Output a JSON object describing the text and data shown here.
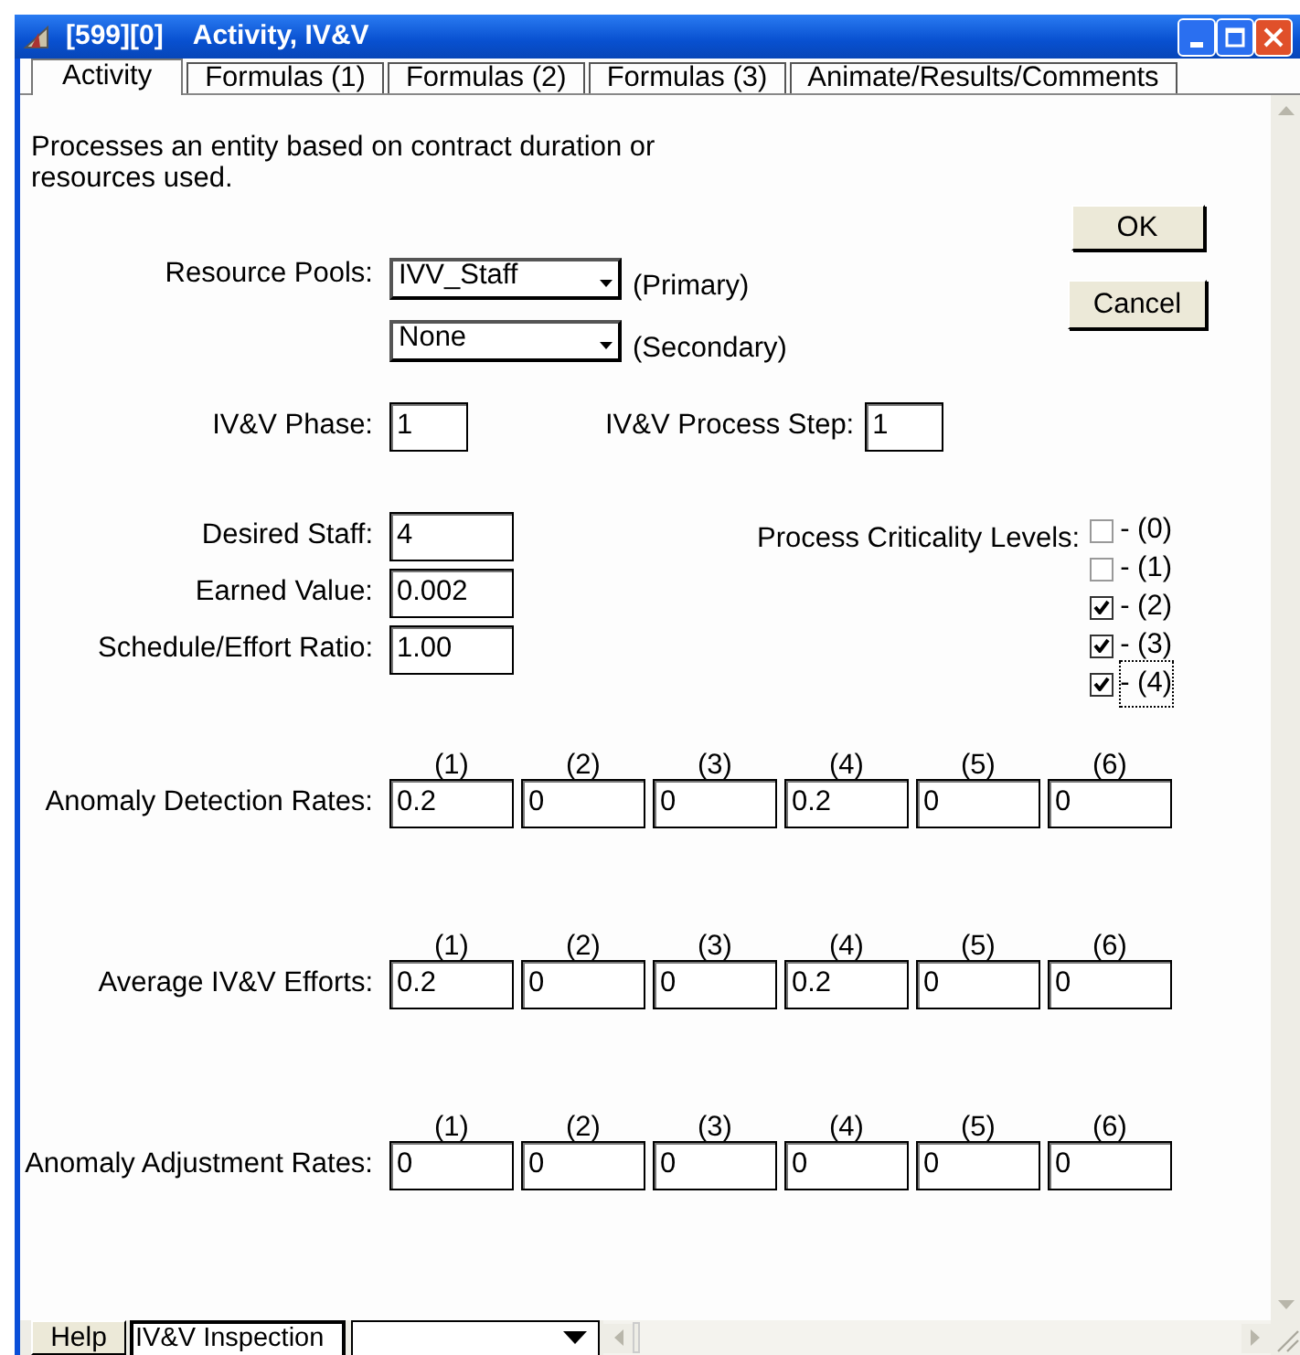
{
  "window": {
    "id": "[599][0]",
    "title": "Activity, IV&V"
  },
  "tabs": [
    {
      "label": "Activity",
      "selected": true
    },
    {
      "label": "Formulas (1)",
      "selected": false
    },
    {
      "label": "Formulas (2)",
      "selected": false
    },
    {
      "label": "Formulas (3)",
      "selected": false
    },
    {
      "label": "Animate/Results/Comments",
      "selected": false
    }
  ],
  "description": "Processes an entity based on contract duration or resources used.",
  "buttons": [
    "OK",
    "Cancel"
  ],
  "resource_pools": {
    "label": "Resource Pools:",
    "pools": [
      {
        "value": "IVV_Staff",
        "note": "(Primary)"
      },
      {
        "value": "None",
        "note": "(Secondary)"
      }
    ]
  },
  "phase": {
    "label": "IV&V Phase:",
    "value": "1"
  },
  "process_step": {
    "label": "IV&V Process Step:",
    "value": "1"
  },
  "fields": [
    {
      "label": "Desired Staff:",
      "value": "4"
    },
    {
      "label": "Earned Value:",
      "value": "0.002"
    },
    {
      "label": "Schedule/Effort Ratio:",
      "value": "1.00"
    }
  ],
  "criticality": {
    "label": "Process Criticality Levels:",
    "levels": [
      {
        "label": "- (0)",
        "checked": false,
        "focused": false
      },
      {
        "label": "- (1)",
        "checked": false,
        "focused": false
      },
      {
        "label": "- (2)",
        "checked": true,
        "focused": false
      },
      {
        "label": "- (3)",
        "checked": true,
        "focused": false
      },
      {
        "label": "- (4)",
        "checked": true,
        "focused": true
      }
    ]
  },
  "rate_groups": [
    {
      "label": "Anomaly Detection Rates:",
      "columns": [
        "(1)",
        "(2)",
        "(3)",
        "(4)",
        "(5)",
        "(6)"
      ],
      "values": [
        "0.2",
        "0",
        "0",
        "0.2",
        "0",
        "0"
      ]
    },
    {
      "label": "Average IV&V Efforts:",
      "columns": [
        "(1)",
        "(2)",
        "(3)",
        "(4)",
        "(5)",
        "(6)"
      ],
      "values": [
        "0.2",
        "0",
        "0",
        "0.2",
        "0",
        "0"
      ]
    },
    {
      "label": "Anomaly Adjustment Rates:",
      "columns": [
        "(1)",
        "(2)",
        "(3)",
        "(4)",
        "(5)",
        "(6)"
      ],
      "values": [
        "0",
        "0",
        "0",
        "0",
        "0",
        "0"
      ]
    }
  ],
  "status_bar": {
    "help": "Help",
    "name": "IV&V Inspection"
  }
}
